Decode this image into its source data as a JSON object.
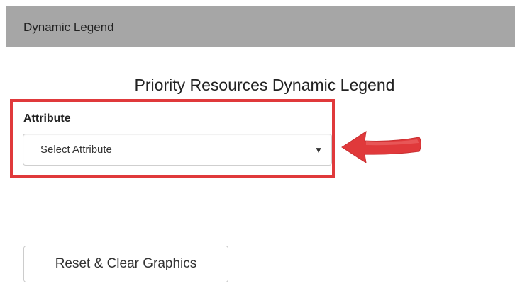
{
  "panel": {
    "title": "Dynamic Legend"
  },
  "legend": {
    "title": "Priority Resources Dynamic Legend"
  },
  "attribute": {
    "label": "Attribute",
    "selected_value": "Select Attribute",
    "caret_icon": "caret-down-icon"
  },
  "annotation": {
    "highlight_color": "#e0393b",
    "arrow_icon": "arrow-left-icon"
  },
  "actions": {
    "reset_label": "Reset & Clear Graphics"
  }
}
